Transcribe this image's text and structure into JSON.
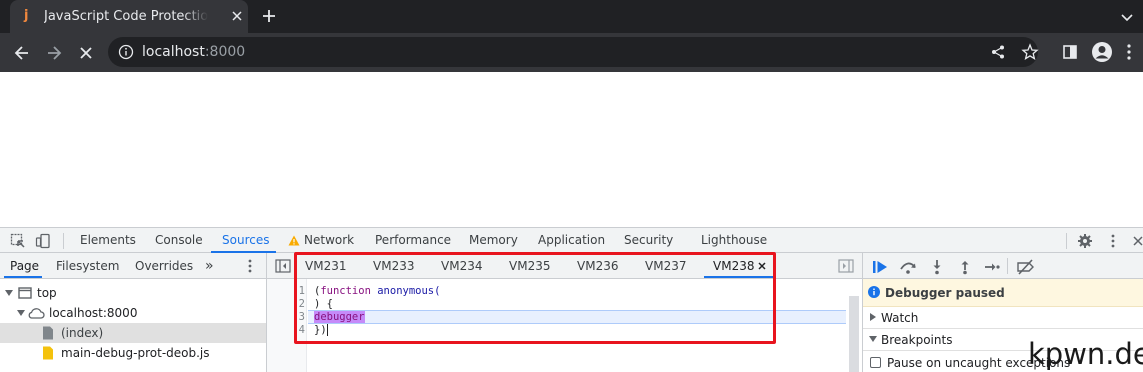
{
  "browser": {
    "tab_title": "JavaScript Code Protection",
    "tab_favicon": "j",
    "url_host": "localhost",
    "url_port": ":8000"
  },
  "devtools": {
    "panels": [
      "Elements",
      "Console",
      "Sources",
      "Network",
      "Performance",
      "Memory",
      "Application",
      "Security",
      "Lighthouse"
    ],
    "active_panel": "Sources",
    "navigator_tabs": [
      "Page",
      "Filesystem",
      "Overrides"
    ],
    "navigator_more": "»",
    "tree": {
      "top": "top",
      "host": "localhost:8000",
      "index": "(index)",
      "script": "main-debug-prot-deob.js"
    },
    "editor_tabs": [
      "VM231",
      "VM233",
      "VM234",
      "VM235",
      "VM236",
      "VM237",
      "VM238"
    ],
    "active_editor_tab": "VM238",
    "code_lines": [
      {
        "num": "1",
        "pre": "(",
        "kw": "function",
        "post": " anonymous("
      },
      {
        "num": "2",
        "text": ") {"
      },
      {
        "num": "3",
        "text": "debugger"
      },
      {
        "num": "4",
        "text": "})"
      }
    ],
    "debugger": {
      "paused_label": "Debugger paused",
      "watch_label": "Watch",
      "breakpoints_label": "Breakpoints",
      "pause_uncaught_label": "Pause on uncaught exceptions"
    }
  },
  "watermark": "kpwn.de",
  "colors": {
    "accent": "#1a73e8",
    "highlight_box": "#e8141e",
    "warning": "#f9ab00",
    "paused_bg": "#fef7e0"
  }
}
